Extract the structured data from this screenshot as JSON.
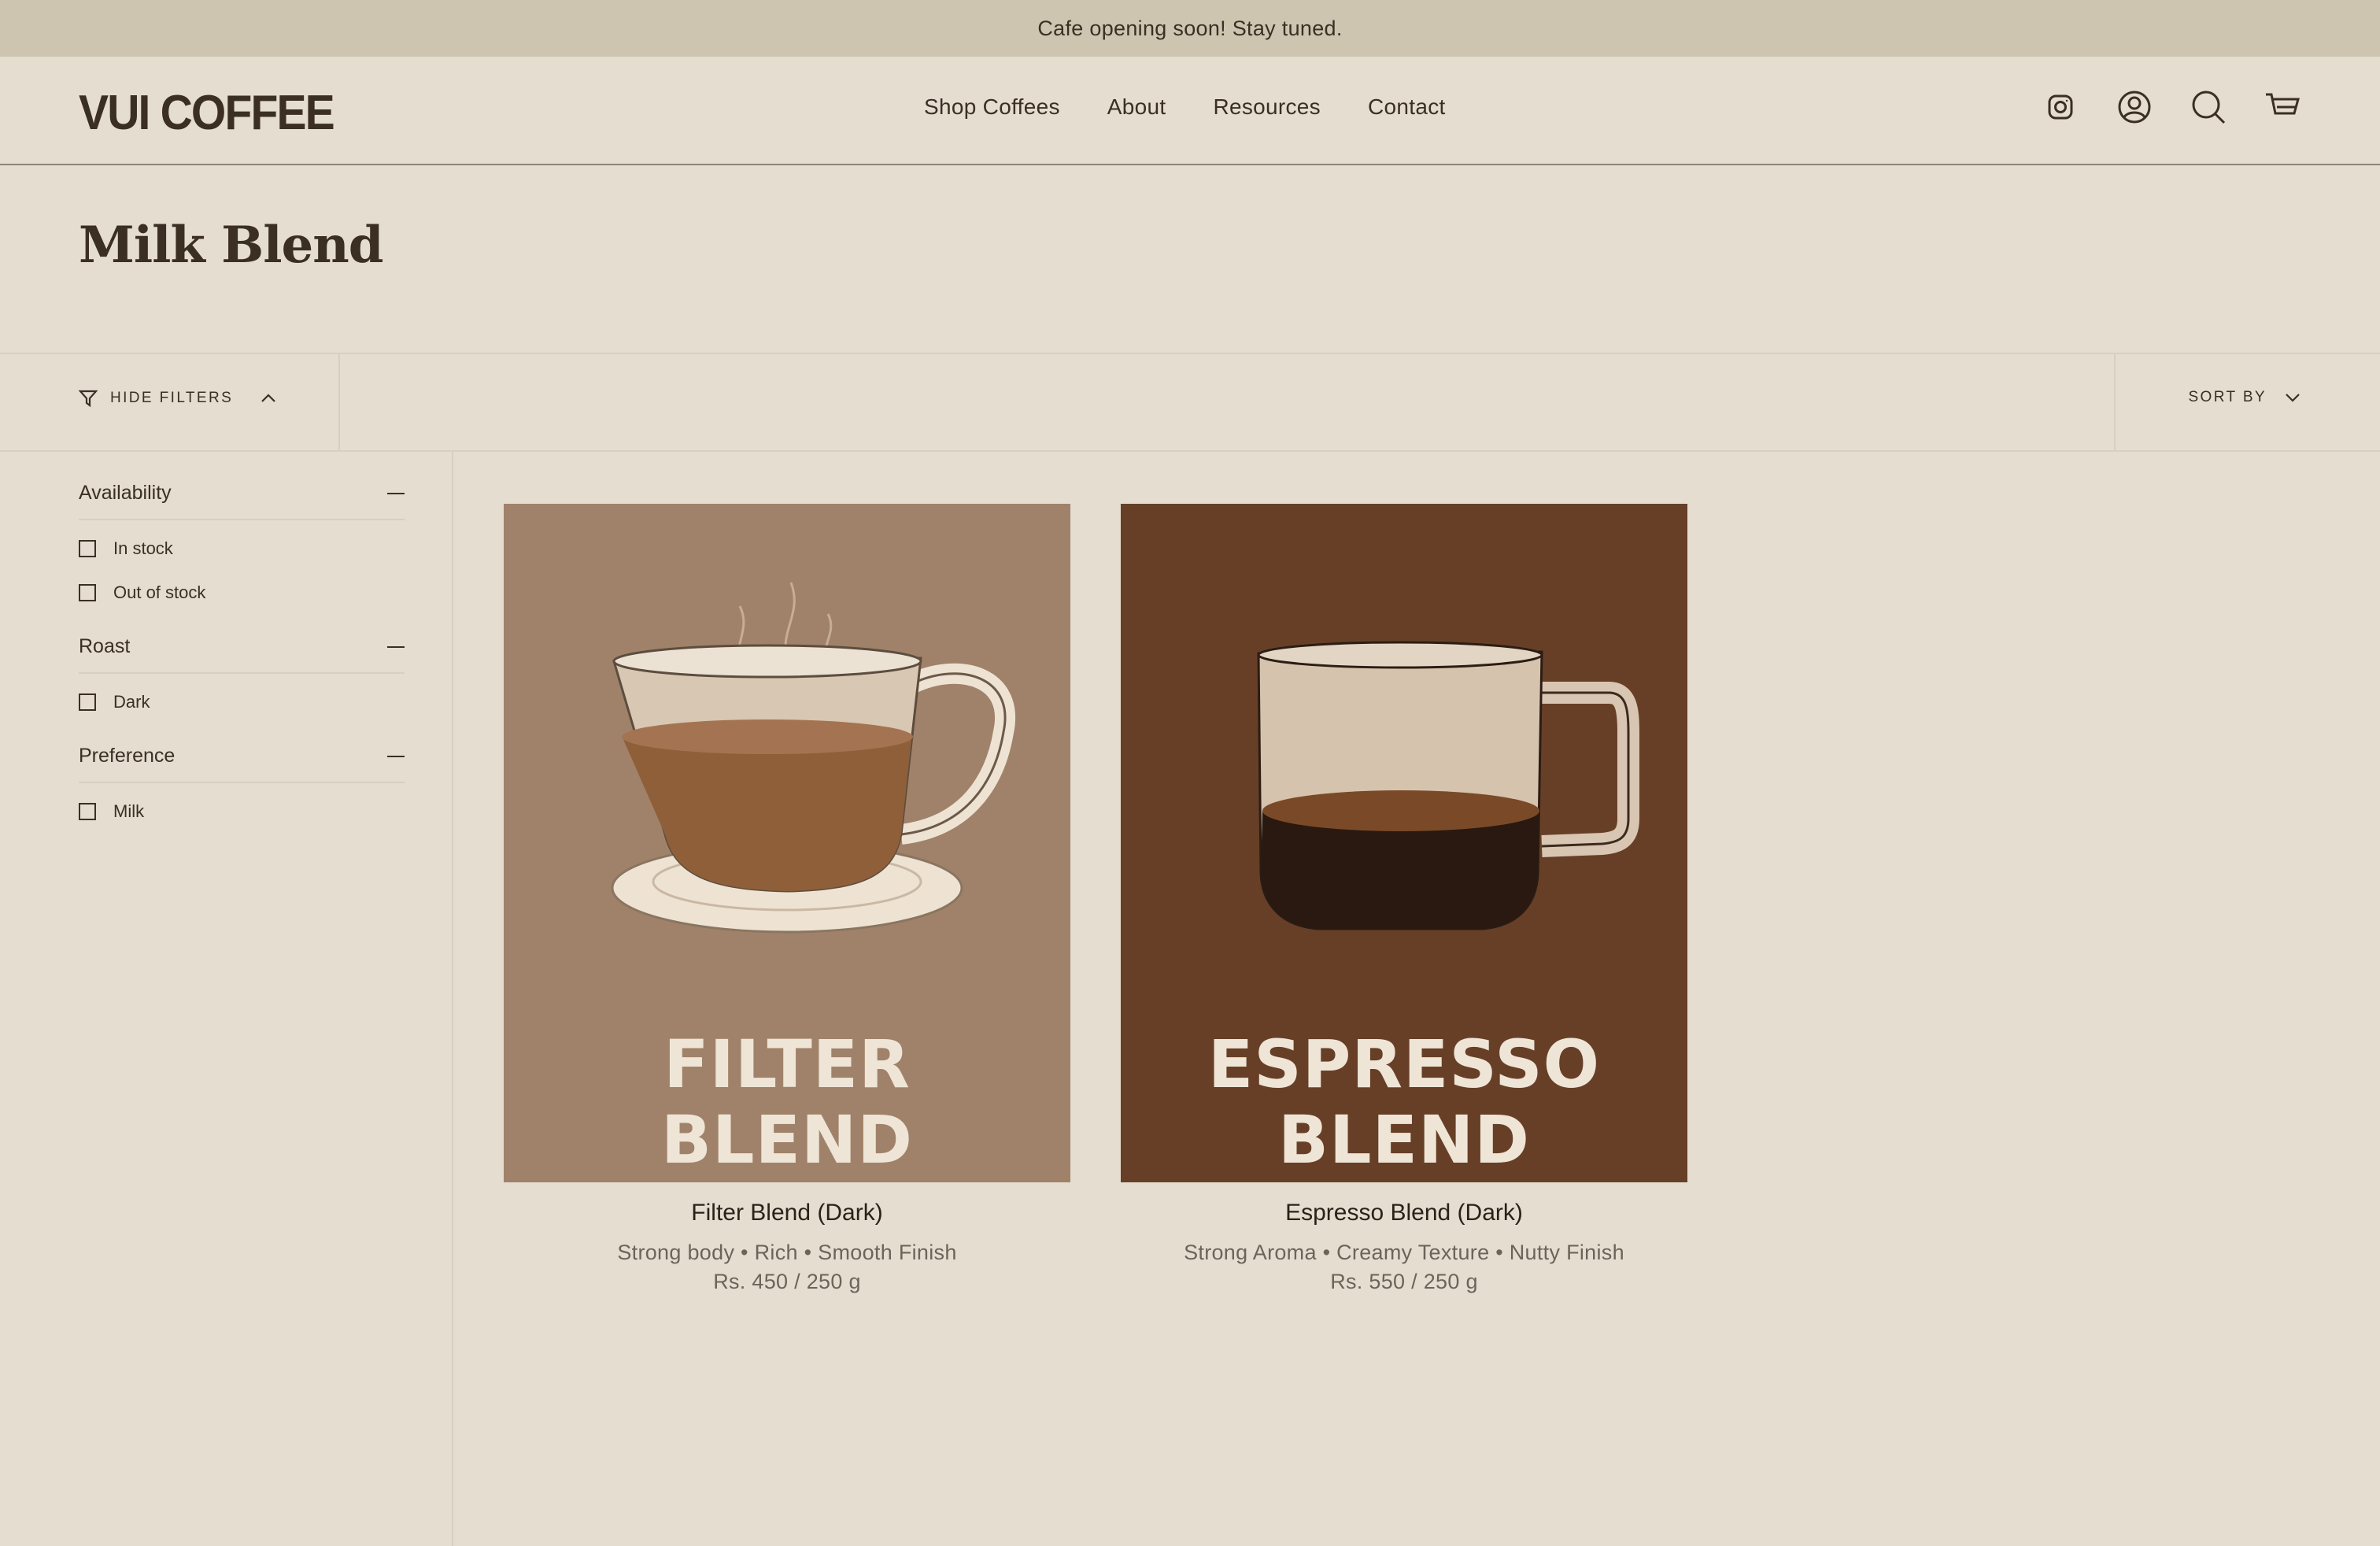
{
  "announcement": "Cafe opening soon! Stay tuned.",
  "brand": "VUI COFFEE",
  "nav": [
    "Shop Coffees",
    "About",
    "Resources",
    "Contact"
  ],
  "header_icons": [
    "instagram-icon",
    "account-icon",
    "search-icon",
    "cart-icon"
  ],
  "page_title": "Milk Blend",
  "toolbar": {
    "hide_filters": "HIDE FILTERS",
    "sort_by": "SORT BY"
  },
  "filters": [
    {
      "title": "Availability",
      "options": [
        "In stock",
        "Out of stock"
      ]
    },
    {
      "title": "Roast",
      "options": [
        "Dark"
      ]
    },
    {
      "title": "Preference",
      "options": [
        "Milk"
      ]
    }
  ],
  "products": [
    {
      "name": "Filter Blend (Dark)",
      "description": "Strong body • Rich • Smooth Finish",
      "price": "Rs. 450 / 250 g",
      "image_text": [
        "FILTER",
        "BLEND"
      ],
      "bg_color": "#a0826a"
    },
    {
      "name": "Espresso Blend (Dark)",
      "description": "Strong Aroma • Creamy Texture • Nutty Finish",
      "price": "Rs. 550 / 250 g",
      "image_text": [
        "ESPRESSO",
        "BLEND"
      ],
      "bg_color": "#673f27"
    }
  ],
  "colors": {
    "page_bg": "#e4ddd0",
    "announcement_bg": "#cdc5b0",
    "text": "#3b2f24"
  }
}
